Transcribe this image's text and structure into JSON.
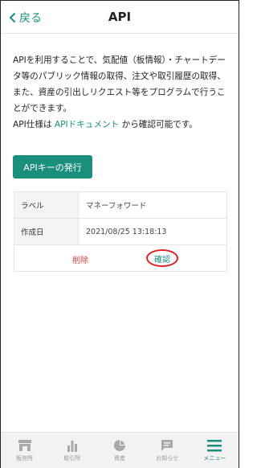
{
  "header": {
    "back_label": "戻る",
    "title": "API"
  },
  "description": {
    "text1": "APIを利用することで、気配値（板情報）・チャートデータ等のパブリック情報の取得、注文や取引履歴の取得、また、資産の引出しリクエスト等をプログラムで行うことができます。",
    "text2_prefix": "API仕様は ",
    "link": "APIドキュメント",
    "text2_suffix": " から確認可能です。"
  },
  "issue_button": "APIキーの発行",
  "api_key": {
    "label_header": "ラベル",
    "label_value": "マネーフォワード",
    "created_header": "作成日",
    "created_value": "2021/08/25 13:18:13",
    "delete_label": "削除",
    "confirm_label": "確認"
  },
  "tabs": [
    {
      "label": "販売所",
      "icon": "store-icon"
    },
    {
      "label": "取引所",
      "icon": "bar-chart-icon"
    },
    {
      "label": "資産",
      "icon": "pie-chart-icon"
    },
    {
      "label": "お知らせ",
      "icon": "message-icon"
    },
    {
      "label": "メニュー",
      "icon": "menu-icon",
      "active": true
    }
  ],
  "colors": {
    "accent": "#1a8f7c",
    "danger": "#d94040",
    "highlight_ring": "#e02020"
  }
}
